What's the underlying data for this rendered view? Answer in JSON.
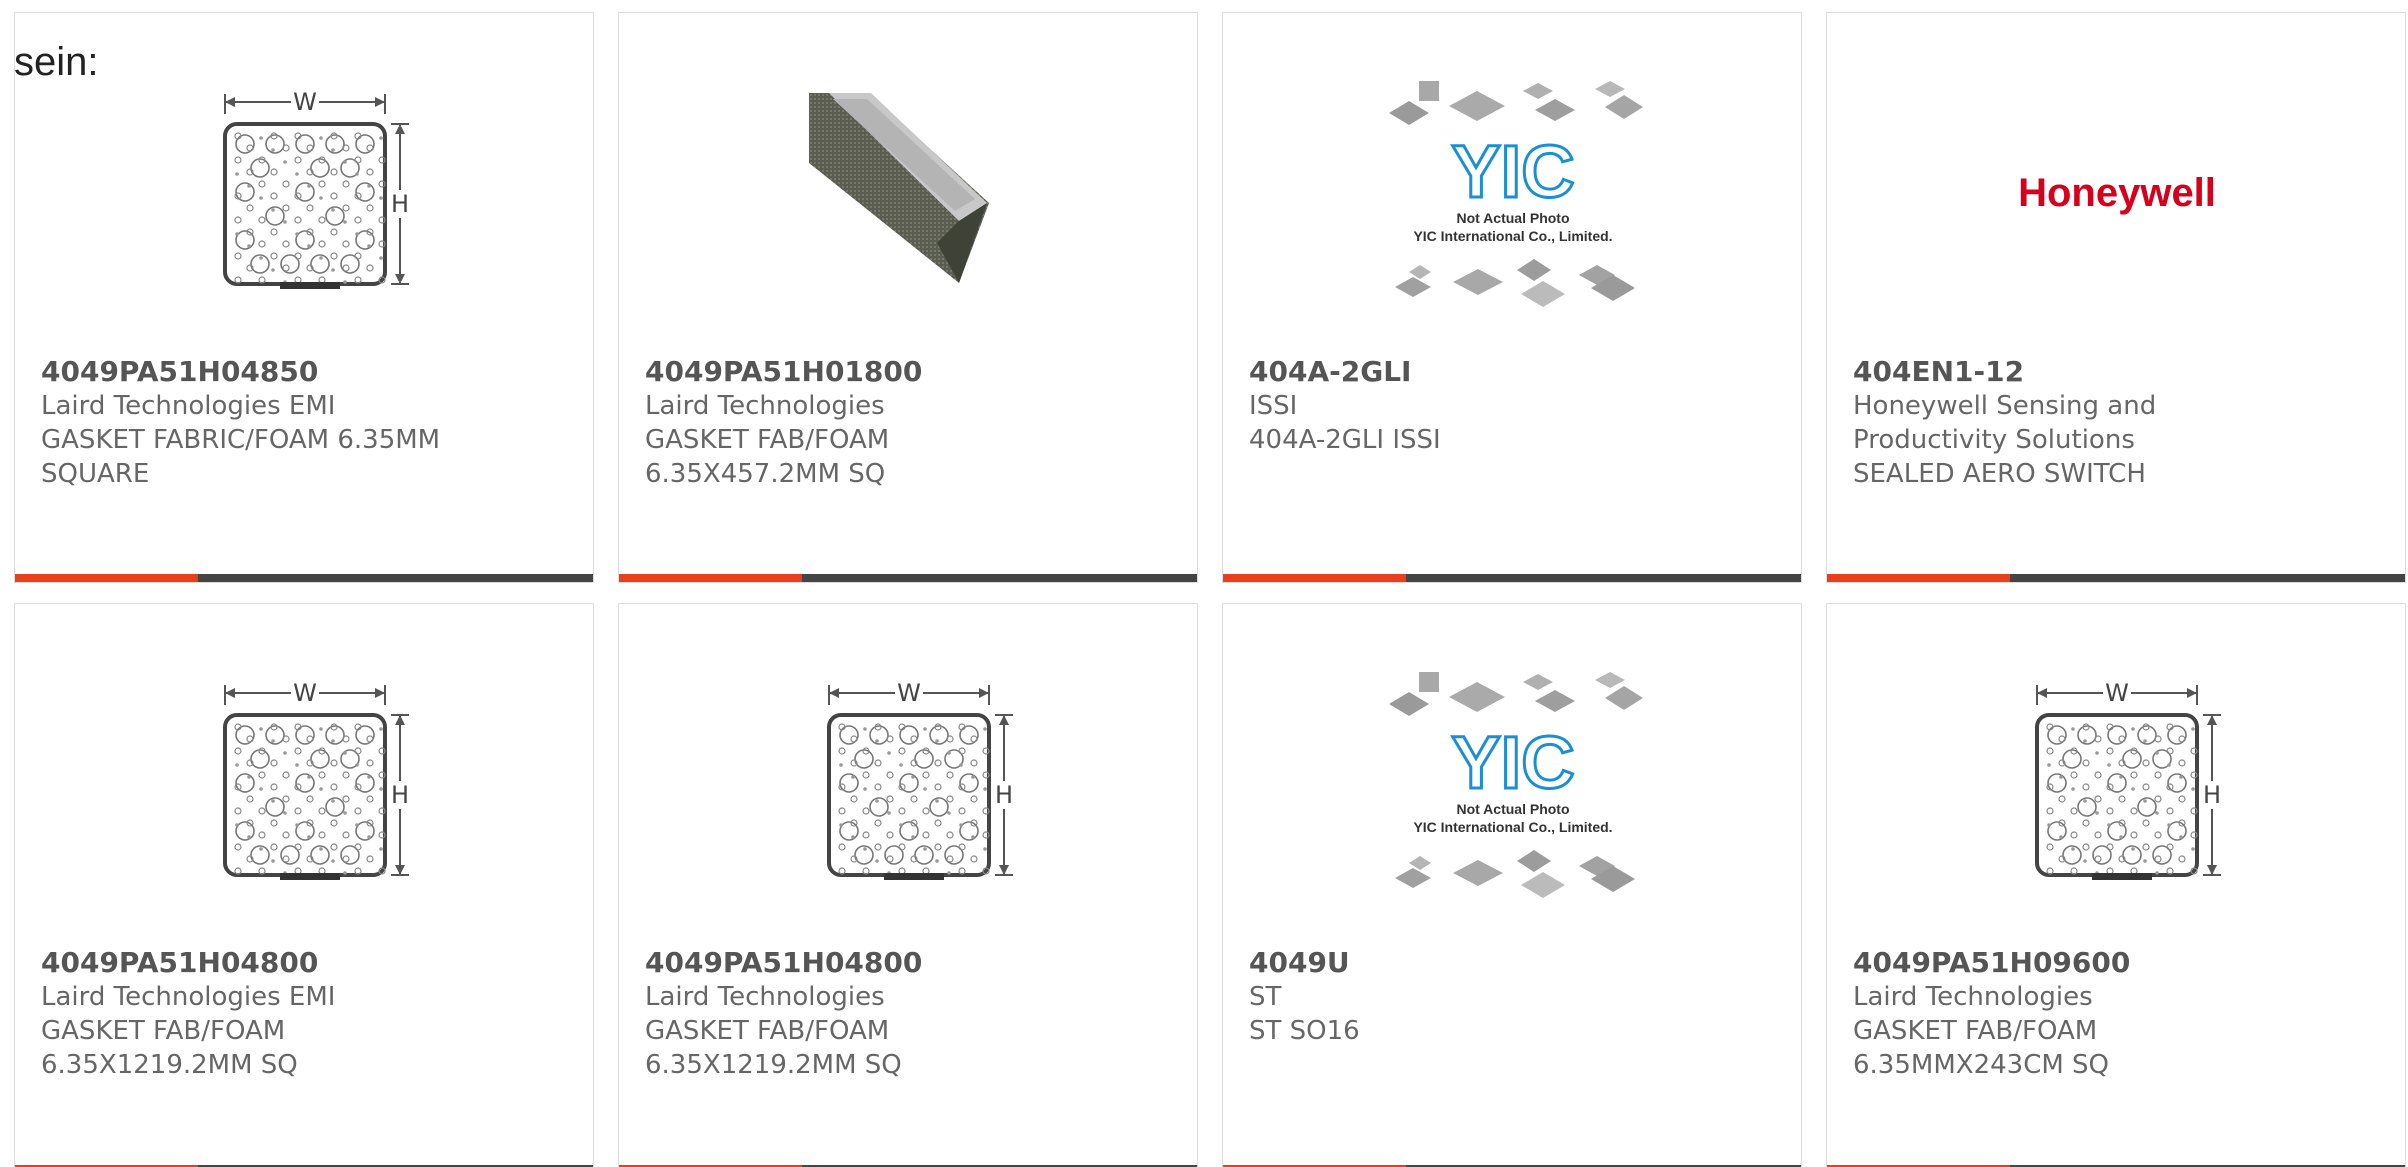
{
  "page": {
    "prefix_text": "sein:"
  },
  "brand": {
    "accent_color": "#e8401c",
    "bar_color": "#444444"
  },
  "products": [
    {
      "part_number": "4049PA51H04850",
      "manufacturer": "Laird Technologies EMI",
      "description": "GASKET FABRIC/FOAM 6.35MM\nSQUARE",
      "image_type": "gasket-diagram",
      "diagram_labels": {
        "width": "W",
        "height": "H"
      }
    },
    {
      "part_number": "4049PA51H01800",
      "manufacturer": "Laird Technologies",
      "description": "GASKET FAB/FOAM\n6.35X457.2MM SQ",
      "image_type": "gasket-photo"
    },
    {
      "part_number": "404A-2GLI",
      "manufacturer": "ISSI",
      "description": "404A-2GLI ISSI",
      "image_type": "placeholder",
      "placeholder": {
        "logo_text": "YIC",
        "caption_line1": "Not Actual Photo",
        "caption_line2": "YIC International Co., Limited."
      }
    },
    {
      "part_number": "404EN1-12",
      "manufacturer": "Honeywell Sensing and\nProductivity Solutions",
      "description": "SEALED AERO SWITCH",
      "image_type": "brand-logo",
      "logo_text": "Honeywell"
    },
    {
      "part_number": "4049PA51H04800",
      "manufacturer": "Laird Technologies EMI",
      "description": "GASKET FAB/FOAM\n6.35X1219.2MM SQ",
      "image_type": "gasket-diagram",
      "diagram_labels": {
        "width": "W",
        "height": "H"
      }
    },
    {
      "part_number": "4049PA51H04800",
      "manufacturer": "Laird Technologies",
      "description": "GASKET FAB/FOAM\n6.35X1219.2MM SQ",
      "image_type": "gasket-diagram",
      "diagram_labels": {
        "width": "W",
        "height": "H"
      }
    },
    {
      "part_number": "4049U",
      "manufacturer": "ST",
      "description": "ST SO16",
      "image_type": "placeholder",
      "placeholder": {
        "logo_text": "YIC",
        "caption_line1": "Not Actual Photo",
        "caption_line2": "YIC International Co., Limited."
      }
    },
    {
      "part_number": "4049PA51H09600",
      "manufacturer": "Laird Technologies",
      "description": "GASKET FAB/FOAM\n6.35MMX243CM SQ",
      "image_type": "gasket-diagram",
      "diagram_labels": {
        "width": "W",
        "height": "H"
      }
    }
  ]
}
